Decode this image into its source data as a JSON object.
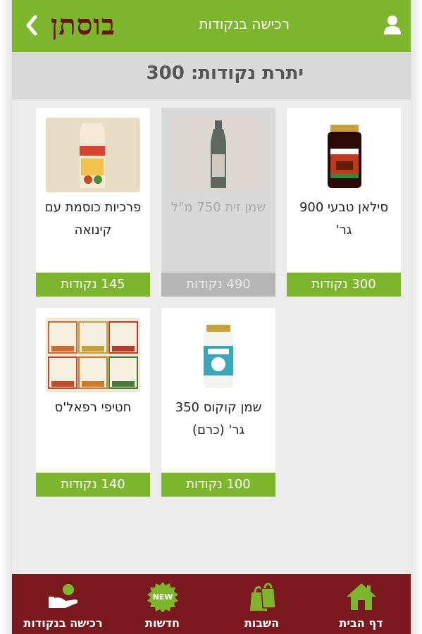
{
  "header": {
    "logo_text": "בוסתן",
    "title": "רכישה בנקודות"
  },
  "balance": {
    "text": "יתרת נקודות: 300"
  },
  "products": [
    {
      "name": "סילאן טבעי 900 גר'",
      "price": "300 נקודות",
      "image": "silan-jar",
      "available": true
    },
    {
      "name": "שמן זית 750 מ\"ל",
      "price": "490 נקודות",
      "image": "olive-oil-bottle",
      "available": false
    },
    {
      "name": "פרכיות כוסמת עם קינואה",
      "price": "145 נקודות",
      "image": "rice-cakes-package",
      "available": true
    },
    {
      "name": "שמן קוקוס 350 גר' (כרם)",
      "price": "100 נקודות",
      "image": "coconut-oil-jar",
      "available": true
    },
    {
      "name": "חטיפי רפאל'ס",
      "price": "140 נקודות",
      "image": "snack-bars-boxes",
      "available": true
    }
  ],
  "bottom_nav": [
    {
      "label": "דף הבית",
      "icon": "home-icon"
    },
    {
      "label": "השבות",
      "icon": "shopping-bags-icon"
    },
    {
      "label": "חדשות",
      "icon": "new-badge-icon",
      "badge_text": "NEW"
    },
    {
      "label": "רכישה בנקודות",
      "icon": "hand-coins-icon"
    }
  ],
  "colors": {
    "brand_green": "#7db62c",
    "brand_maroon": "#7a1a1e",
    "logo": "#6b1418",
    "disabled_gray": "#b3b3b3"
  }
}
